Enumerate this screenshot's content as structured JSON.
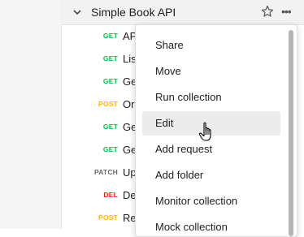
{
  "collection": {
    "title": "Simple Book API",
    "expand_icon": "chevron-down-icon",
    "star_icon": "star-icon",
    "more_icon": "more-horizontal-icon",
    "more_glyph": "•••"
  },
  "requests": [
    {
      "method": "GET",
      "name": "API",
      "color": "#0cbb52"
    },
    {
      "method": "GET",
      "name": "List",
      "color": "#0cbb52"
    },
    {
      "method": "GET",
      "name": "Get",
      "color": "#0cbb52"
    },
    {
      "method": "POST",
      "name": "Or",
      "color": "#ffb400"
    },
    {
      "method": "GET",
      "name": "Get",
      "color": "#0cbb52"
    },
    {
      "method": "GET",
      "name": "Get",
      "color": "#0cbb52"
    },
    {
      "method": "PATCH",
      "name": "Up",
      "color": "#6b6b6b"
    },
    {
      "method": "DEL",
      "name": "De",
      "color": "#eb2013"
    },
    {
      "method": "POST",
      "name": "Re",
      "color": "#ffb400"
    }
  ],
  "menu": {
    "items": [
      {
        "label": "Share"
      },
      {
        "label": "Move"
      },
      {
        "label": "Run collection"
      },
      {
        "label": "Edit",
        "active": true
      },
      {
        "label": "Add request"
      },
      {
        "label": "Add folder"
      },
      {
        "label": "Monitor collection"
      },
      {
        "label": "Mock collection"
      }
    ]
  }
}
